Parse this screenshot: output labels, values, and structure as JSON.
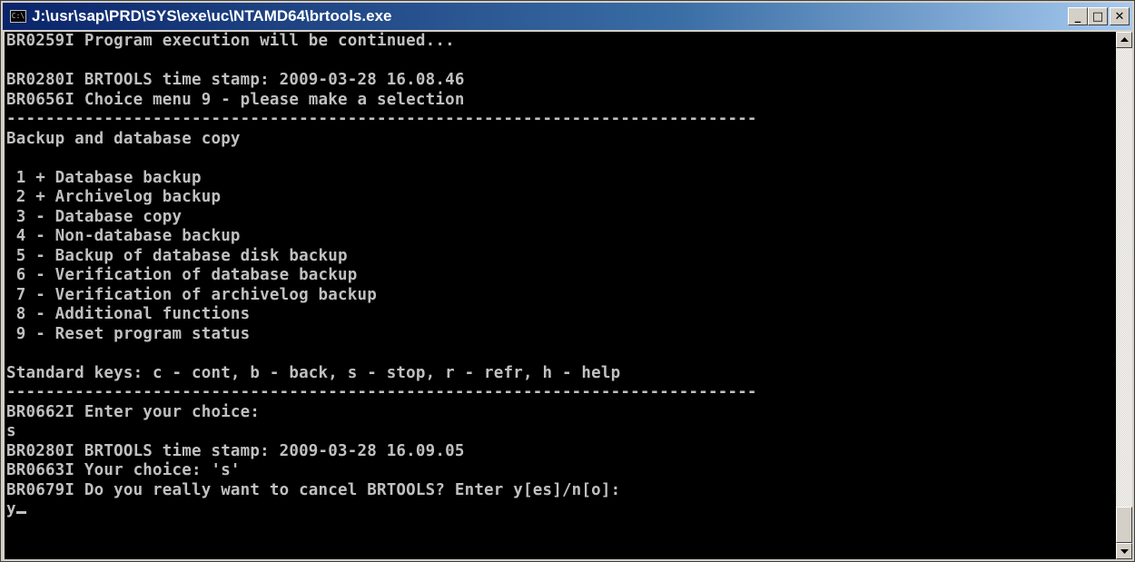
{
  "window": {
    "title": "J:\\usr\\sap\\PRD\\SYS\\exe\\uc\\NTAMD64\\brtools.exe",
    "minimize_label": "_",
    "maximize_label": "□",
    "close_label": "✕",
    "app_icon_label": "C:\\"
  },
  "console": {
    "lines": [
      "BR0259I Program execution will be continued...",
      "",
      "BR0280I BRTOOLS time stamp: 2009-03-28 16.08.46",
      "BR0656I Choice menu 9 - please make a selection",
      "-----------------------------------------------------------------------------",
      "Backup and database copy",
      "",
      " 1 + Database backup",
      " 2 + Archivelog backup",
      " 3 - Database copy",
      " 4 - Non-database backup",
      " 5 - Backup of database disk backup",
      " 6 - Verification of database backup",
      " 7 - Verification of archivelog backup",
      " 8 - Additional functions",
      " 9 - Reset program status",
      "",
      "Standard keys: c - cont, b - back, s - stop, r - refr, h - help",
      "-----------------------------------------------------------------------------",
      "BR0662I Enter your choice:",
      "s",
      "BR0280I BRTOOLS time stamp: 2009-03-28 16.09.05",
      "BR0663I Your choice: 's'",
      "BR0679I Do you really want to cancel BRTOOLS? Enter y[es]/n[o]:",
      "y"
    ]
  },
  "colors": {
    "console_background": "#000000",
    "console_text": "#c0c0c0",
    "titlebar_start": "#0a246a",
    "titlebar_end": "#a6caf0"
  },
  "icons": {
    "app": "console-icon",
    "scroll_up": "arrow-up-icon",
    "scroll_down": "arrow-down-icon"
  }
}
